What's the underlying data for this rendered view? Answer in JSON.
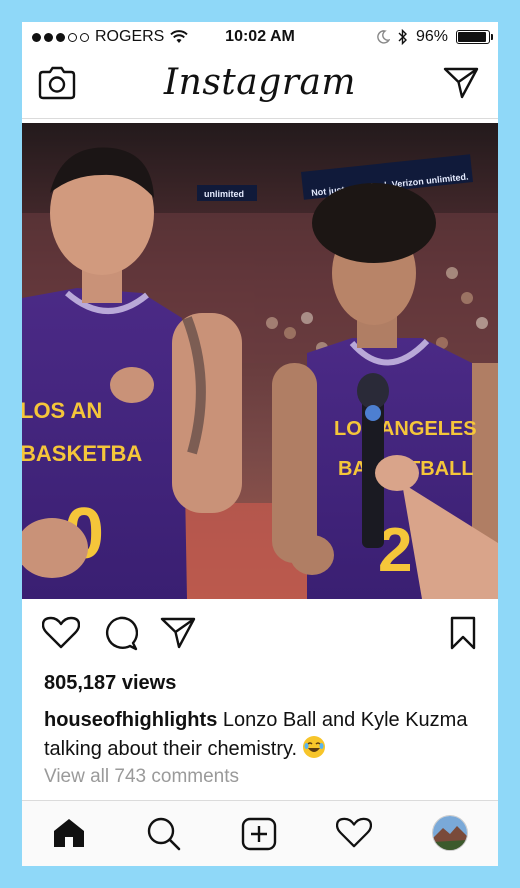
{
  "status_bar": {
    "carrier": "ROGERS",
    "time": "10:02 AM",
    "battery": "96%",
    "battery_level": 0.96
  },
  "header": {
    "title": "Instagram",
    "left_icon": "camera-icon",
    "right_icon": "direct-message-icon"
  },
  "post": {
    "photo_banner_left": "unlimited",
    "photo_banner_right": "Not just unlimited. Verizon unlimited.",
    "jersey_left": [
      "LOS AN",
      "BASKETBA",
      "0"
    ],
    "jersey_right": [
      "LOS ANGELES",
      "BASKETBALL",
      "2"
    ],
    "views": "805,187 views",
    "username": "houseofhighlights",
    "caption": " Lonzo Ball and Kyle Kuzma talking about their chemistry. ",
    "comments_link": "View all 743 comments"
  },
  "actions": {
    "like": "heart-icon",
    "comment": "comment-icon",
    "share": "send-icon",
    "save": "bookmark-icon"
  },
  "tabbar": [
    "home-icon",
    "search-icon",
    "add-post-icon",
    "activity-icon",
    "profile-avatar"
  ]
}
